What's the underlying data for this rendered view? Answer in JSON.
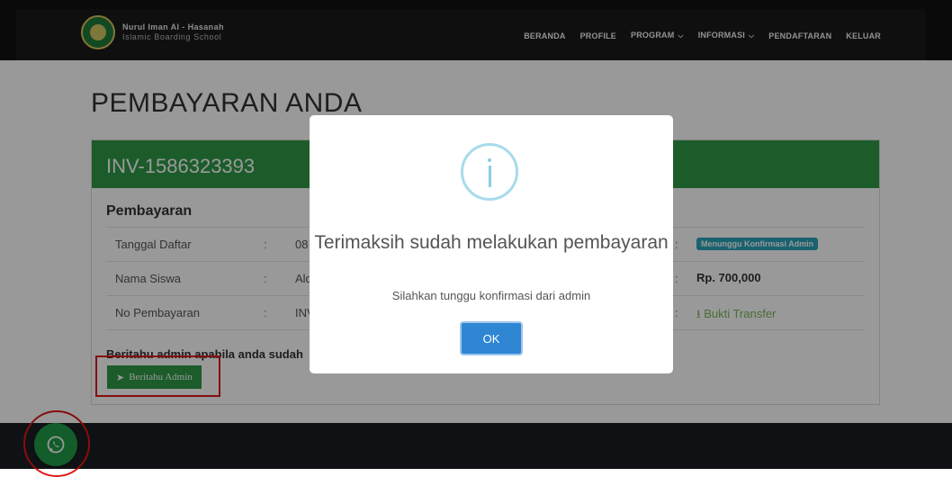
{
  "brand": {
    "name": "Nurul Iman Al - Hasanah",
    "subtitle": "Islamic Boarding School"
  },
  "nav": {
    "items": [
      {
        "label": "BERANDA"
      },
      {
        "label": "PROFILE"
      },
      {
        "label": "PROGRAM",
        "dropdown": true
      },
      {
        "label": "INFORMASI",
        "dropdown": true
      },
      {
        "label": "PENDAFTARAN"
      },
      {
        "label": "KELUAR"
      }
    ]
  },
  "page": {
    "title": "PEMBAYARAN ANDA"
  },
  "invoice": {
    "number": "INV-1586323393",
    "section_title": "Pembayaran",
    "rows": [
      {
        "label": "Tanggal Daftar",
        "sep": ":",
        "value": "08",
        "sep2": ":",
        "right": "Menunggu Konfirmasi Admin"
      },
      {
        "label": "Nama Siswa",
        "sep": ":",
        "value": "Ald",
        "sep2": ":",
        "right": "Rp. 700,000"
      },
      {
        "label": "No Pembayaran",
        "sep": ":",
        "value": "INV",
        "sep2": ":",
        "right": "Bukti Transfer"
      }
    ],
    "notify_text": "Beritahu admin apabila anda sudah",
    "notify_button": "Beritahu Admin"
  },
  "modal": {
    "title": "Terimaksih sudah melakukan pembayaran",
    "text": "Silahkan tunggu konfirmasi dari admin",
    "ok": "OK"
  },
  "colors": {
    "green": "#2e9a46",
    "badge": "#2aa3b9",
    "ok_button": "#2f86d3",
    "annotation_red": "#e01818"
  },
  "icons": {
    "whatsapp": "whatsapp-icon",
    "info": "info-icon",
    "send": "paper-plane-icon",
    "download": "download-icon",
    "chevron": "chevron-down-icon"
  }
}
